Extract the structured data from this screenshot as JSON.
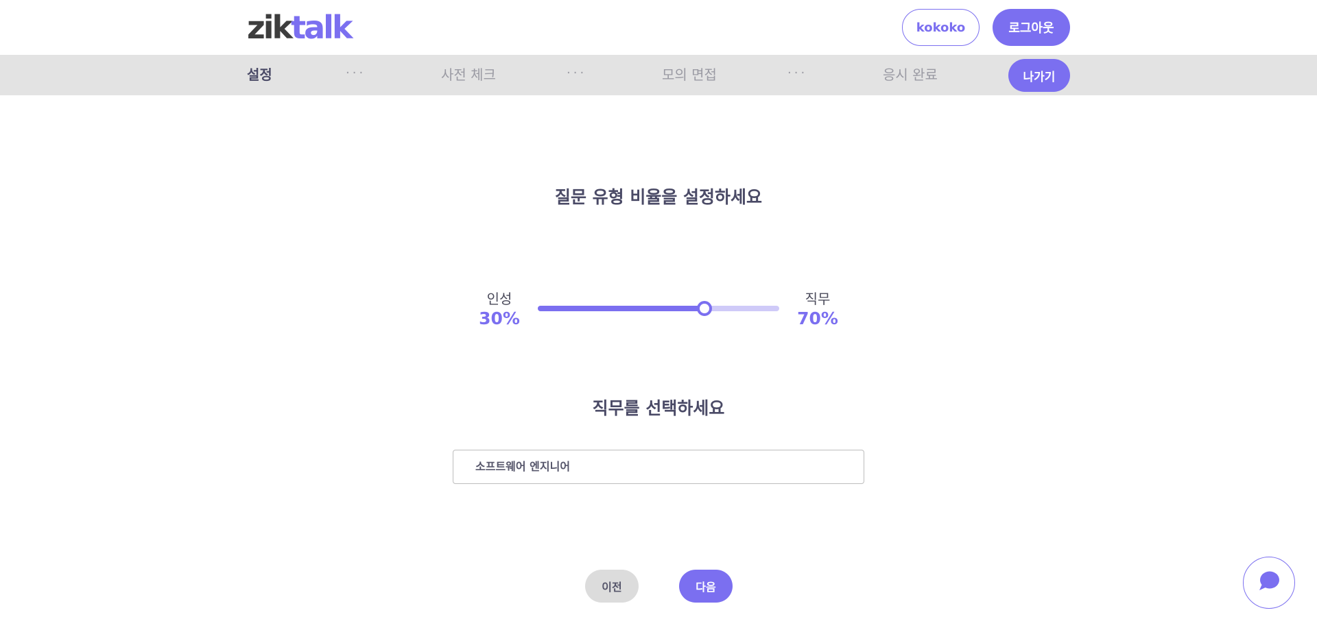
{
  "header": {
    "logo_part1": "zik",
    "logo_part2": "talk",
    "user_label": "kokoko",
    "logout_label": "로그아웃"
  },
  "steps": {
    "items": [
      {
        "label": "설정",
        "active": true
      },
      {
        "label": "사전 체크",
        "active": false
      },
      {
        "label": "모의 면접",
        "active": false
      },
      {
        "label": "응시 완료",
        "active": false
      }
    ],
    "separator": "···",
    "exit_label": "나가기"
  },
  "ratio": {
    "title": "질문 유형 비율을 설정하세요",
    "left_label": "인성",
    "left_value": "30%",
    "right_label": "직무",
    "right_value": "70%",
    "slider_level": 0.69
  },
  "job": {
    "title": "직무를 선택하세요",
    "selected": "소프트웨어 엔지니어"
  },
  "nav": {
    "prev_label": "이전",
    "next_label": "다음"
  },
  "colors": {
    "accent": "#7b6ff0",
    "accent_light": "#cfcaf8",
    "stepbar_bg": "#e3e3e3"
  },
  "icons": {
    "chat": "chat-bubble-icon"
  }
}
